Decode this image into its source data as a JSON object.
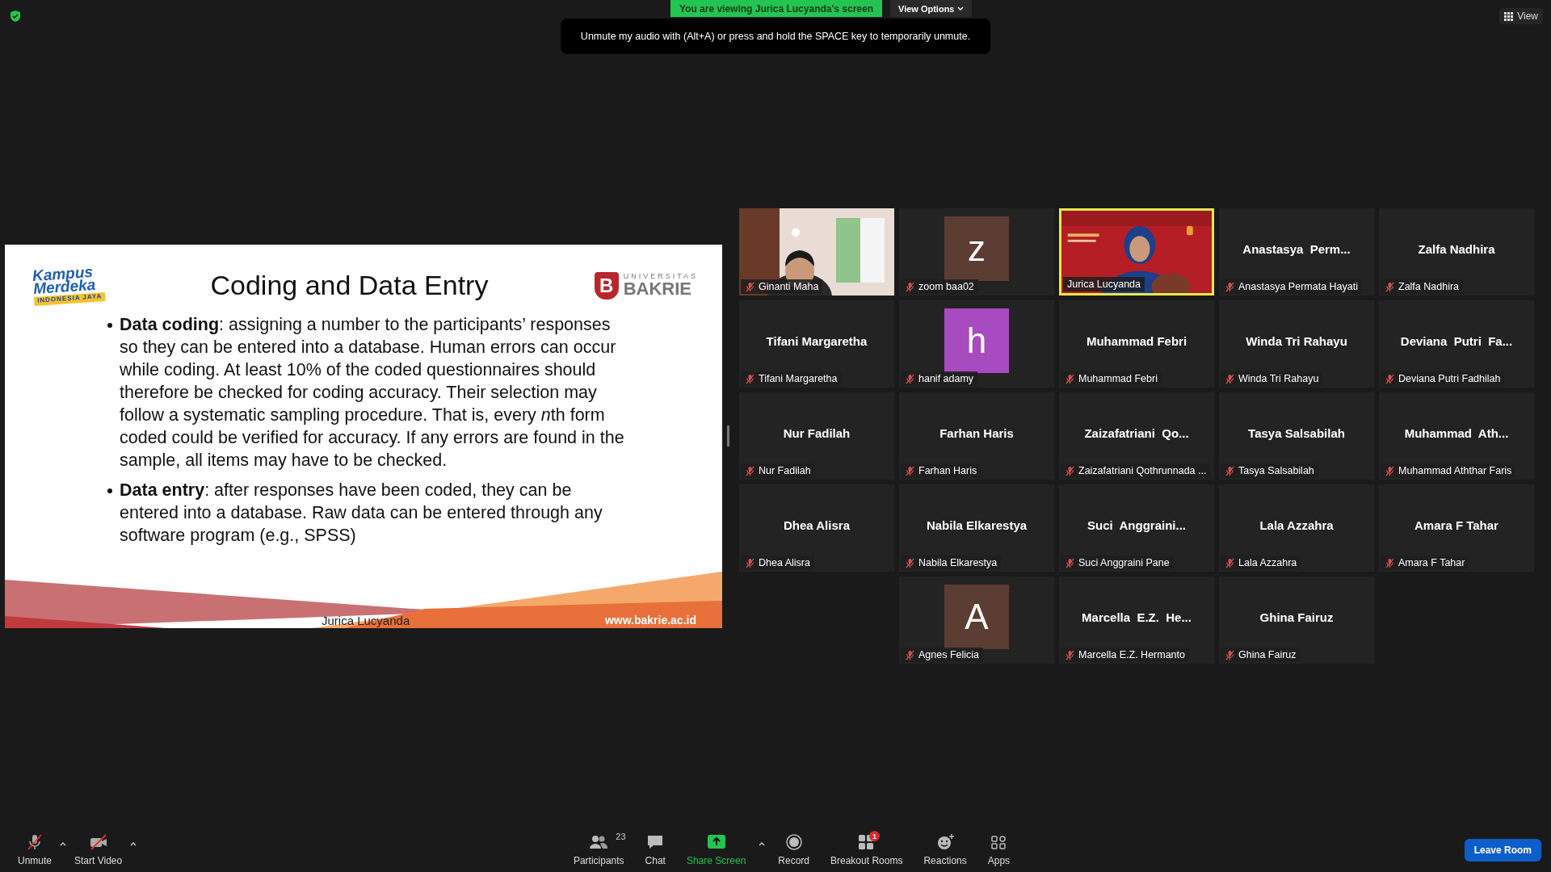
{
  "top_bar": {
    "viewing_banner": "You are viewing Jurica Lucyanda's screen",
    "view_options": "View Options",
    "view_button": "View",
    "tooltip": "Unmute my audio with (Alt+A) or press and hold the SPACE key to temporarily unmute."
  },
  "slide": {
    "logo_left": {
      "line_1": "Kampus",
      "line_2": "Merdeka",
      "ribbon": "INDONESIA JAYA"
    },
    "title": "Coding and Data Entry",
    "logo_right": {
      "mark": "B",
      "line_1": "UNIVERSITAS",
      "line_2": "BAKRIE"
    },
    "bullets": [
      [
        {
          "kind": "term",
          "text": "Data coding"
        },
        {
          "kind": "text",
          "text": ": assigning a number to the participants’ responses so they can be entered into a database. Human errors can occur while coding. At least 10% of the coded questionnaires should therefore be checked for coding accuracy. Their selection may follow a systematic sampling procedure. That is, every "
        },
        {
          "kind": "variable",
          "text": "n"
        },
        {
          "kind": "text",
          "text": "th form coded could be verified for accuracy. If any errors are found in the sample, all items may have to be checked."
        }
      ],
      [
        {
          "kind": "term",
          "text": "Data entry"
        },
        {
          "kind": "text",
          "text": ": after responses have been coded, they can be entered into a database. Raw data can be entered through any software program (e.g., SPSS)"
        }
      ]
    ],
    "footer_left": "Jurica Lucyanda",
    "footer_right": "www.bakrie.ac.id"
  },
  "participants": [
    {
      "kind": "video",
      "label": "Ginanti Maha",
      "muted": true,
      "speaking": false
    },
    {
      "kind": "avatar",
      "initial": "z",
      "color": "#5c3d33",
      "label": "zoom baa02",
      "muted": true,
      "speaking": false
    },
    {
      "kind": "video",
      "label": "Jurica Lucyanda",
      "muted": false,
      "speaking": true
    },
    {
      "kind": "name",
      "display": "Anastasya  Perm...",
      "label": "Anastasya Permata Hayati",
      "muted": true,
      "speaking": false
    },
    {
      "kind": "name",
      "display": "Zalfa Nadhira",
      "label": "Zalfa Nadhira",
      "muted": true,
      "speaking": false
    },
    {
      "kind": "name",
      "display": "Tifani Margaretha",
      "label": "Tifani Margaretha",
      "muted": true,
      "speaking": false
    },
    {
      "kind": "avatar",
      "initial": "h",
      "color": "#a84bc0",
      "label": "hanif adamy",
      "muted": true,
      "speaking": false
    },
    {
      "kind": "name",
      "display": "Muhammad Febri",
      "label": "Muhammad Febri",
      "muted": true,
      "speaking": false
    },
    {
      "kind": "name",
      "display": "Winda Tri Rahayu",
      "label": "Winda Tri Rahayu",
      "muted": true,
      "speaking": false
    },
    {
      "kind": "name",
      "display": "Deviana  Putri  Fa...",
      "label": "Deviana Putri Fadhilah",
      "muted": true,
      "speaking": false
    },
    {
      "kind": "name",
      "display": "Nur Fadilah",
      "label": "Nur Fadilah",
      "muted": true,
      "speaking": false
    },
    {
      "kind": "name",
      "display": "Farhan Haris",
      "label": "Farhan Haris",
      "muted": true,
      "speaking": false
    },
    {
      "kind": "name",
      "display": "Zaizafatriani  Qo...",
      "label": "Zaizafatriani Qothrunnada ...",
      "muted": true,
      "speaking": false
    },
    {
      "kind": "name",
      "display": "Tasya Salsabilah",
      "label": "Tasya Salsabilah",
      "muted": true,
      "speaking": false
    },
    {
      "kind": "name",
      "display": "Muhammad  Ath...",
      "label": "Muhammad Aththar Faris",
      "muted": true,
      "speaking": false
    },
    {
      "kind": "name",
      "display": "Dhea Alisra",
      "label": "Dhea Alisra",
      "muted": true,
      "speaking": false
    },
    {
      "kind": "name",
      "display": "Nabila Elkarestya",
      "label": "Nabila Elkarestya",
      "muted": true,
      "speaking": false
    },
    {
      "kind": "name",
      "display": "Suci  Anggraini...",
      "label": "Suci Anggraini Pane",
      "muted": true,
      "speaking": false
    },
    {
      "kind": "name",
      "display": "Lala Azzahra",
      "label": "Lala Azzahra",
      "muted": true,
      "speaking": false
    },
    {
      "kind": "name",
      "display": "Amara F Tahar",
      "label": "Amara F Tahar",
      "muted": true,
      "speaking": false
    },
    {
      "kind": "avatar",
      "initial": "A",
      "color": "#5c3d33",
      "label": "Agnes Felicia",
      "muted": true,
      "speaking": false
    },
    {
      "kind": "name",
      "display": "Marcella  E.Z.  He...",
      "label": "Marcella E.Z. Hermanto",
      "muted": true,
      "speaking": false
    },
    {
      "kind": "name",
      "display": "Ghina Fairuz",
      "label": "Ghina Fairuz",
      "muted": true,
      "speaking": false
    }
  ],
  "toolbar": {
    "left": [
      {
        "kind": "mic",
        "label": "Unmute"
      },
      {
        "kind": "video",
        "label": "Start Video"
      }
    ],
    "center": [
      {
        "kind": "participants",
        "label": "Participants",
        "count": "23"
      },
      {
        "kind": "chat",
        "label": "Chat"
      },
      {
        "kind": "share",
        "label": "Share Screen"
      },
      {
        "kind": "record",
        "label": "Record"
      },
      {
        "kind": "breakout",
        "label": "Breakout Rooms",
        "badge": "1"
      },
      {
        "kind": "reactions",
        "label": "Reactions"
      },
      {
        "kind": "apps",
        "label": "Apps"
      }
    ],
    "leave": "Leave Room"
  }
}
